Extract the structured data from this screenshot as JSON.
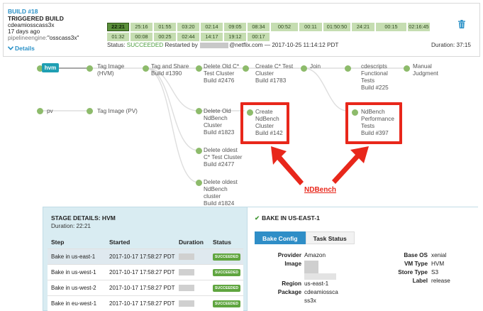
{
  "build": {
    "title": "BUILD #18",
    "trigger": "TRIGGERED BUILD",
    "user": "cdeamiosscass3x",
    "age": "17 days ago",
    "engine_label": "pipelineengine:",
    "engine_value": "\"osscass3x\"",
    "details_label": "Details",
    "durations": [
      "22:21",
      "25:16",
      "01:55",
      "03:20",
      "02:14",
      "09:05",
      "08:34",
      "00:52",
      "00:11",
      "01:50:50",
      "24:21",
      "00:15",
      "02:16:45",
      "01:32",
      "00:08",
      "00:25",
      "02:44",
      "14:17",
      "19:12",
      "00:17"
    ],
    "status_prefix": "Status:",
    "status_value": "SUCCEEDED",
    "restarted_by": "Restarted by",
    "restarted_suffix": "@netflix.com — 2017-10-25 11:14:12 PDT",
    "duration_total": "Duration: 37:15",
    "colors": {
      "accent": "#2a91c7",
      "success": "#4a9b3c",
      "highlight": "#e8271b"
    }
  },
  "graph": {
    "badge": "hvm",
    "nodes": {
      "pv": "pv",
      "tag_hvm": [
        "Tag Image",
        "(HVM)"
      ],
      "tag_pv": "Tag Image (PV)",
      "tag_share": [
        "Tag and Share",
        "Build #1390"
      ],
      "del_c_test": [
        "Delete Old C*",
        "Test Cluster",
        "Build #2476"
      ],
      "create_c_test": [
        "Create C* Test",
        "Cluster",
        "Build #1783"
      ],
      "join": "Join",
      "cdescripts": [
        "cdescripts",
        "Functional",
        "Tests",
        "Build #225"
      ],
      "manual": [
        "Manual",
        "Judgment"
      ],
      "del_ndb": [
        "Delete Old",
        "NdBench",
        "Cluster",
        "Build #1823"
      ],
      "create_ndb": [
        "Create",
        "NdBench",
        "Cluster",
        "Build #142"
      ],
      "ndb_perf": [
        "NdBench",
        "Performance",
        "Tests",
        "Build #397"
      ],
      "del_oldest_c": [
        "Delete oldest",
        "C* Test Cluster",
        "Build #2477"
      ],
      "del_oldest_ndb": [
        "Delete oldest",
        "NdBench",
        "cluster",
        "Build #1824"
      ]
    },
    "annotation": "NDBench"
  },
  "stage": {
    "header": "STAGE DETAILS: HVM",
    "duration": "Duration: 22:21",
    "columns": [
      "Step",
      "Started",
      "Duration",
      "Status"
    ],
    "rows": [
      {
        "step": "Bake in us-east-1",
        "started": "2017-10-17 17:58:27 PDT",
        "status": "SUCCEEDED"
      },
      {
        "step": "Bake in us-west-1",
        "started": "2017-10-17 17:58:27 PDT",
        "status": "SUCCEEDED"
      },
      {
        "step": "Bake in us-west-2",
        "started": "2017-10-17 17:58:27 PDT",
        "status": "SUCCEEDED"
      },
      {
        "step": "Bake in eu-west-1",
        "started": "2017-10-17 17:58:27 PDT",
        "status": "SUCCEEDED"
      }
    ]
  },
  "bake": {
    "header": "BAKE IN US-EAST-1",
    "tabs": [
      "Bake Config",
      "Task Status"
    ],
    "fields_left": [
      {
        "k": "Provider",
        "v": "Amazon"
      },
      {
        "k": "Image",
        "v": ""
      },
      {
        "k": "Region",
        "v": "us-east-1"
      },
      {
        "k": "Package",
        "v": "cdeamiossca"
      },
      {
        "k": "",
        "v": "ss3x"
      }
    ],
    "fields_right": [
      {
        "k": "Base OS",
        "v": "xenial"
      },
      {
        "k": "VM Type",
        "v": "HVM"
      },
      {
        "k": "Store Type",
        "v": "S3"
      },
      {
        "k": "Label",
        "v": "release"
      }
    ]
  }
}
